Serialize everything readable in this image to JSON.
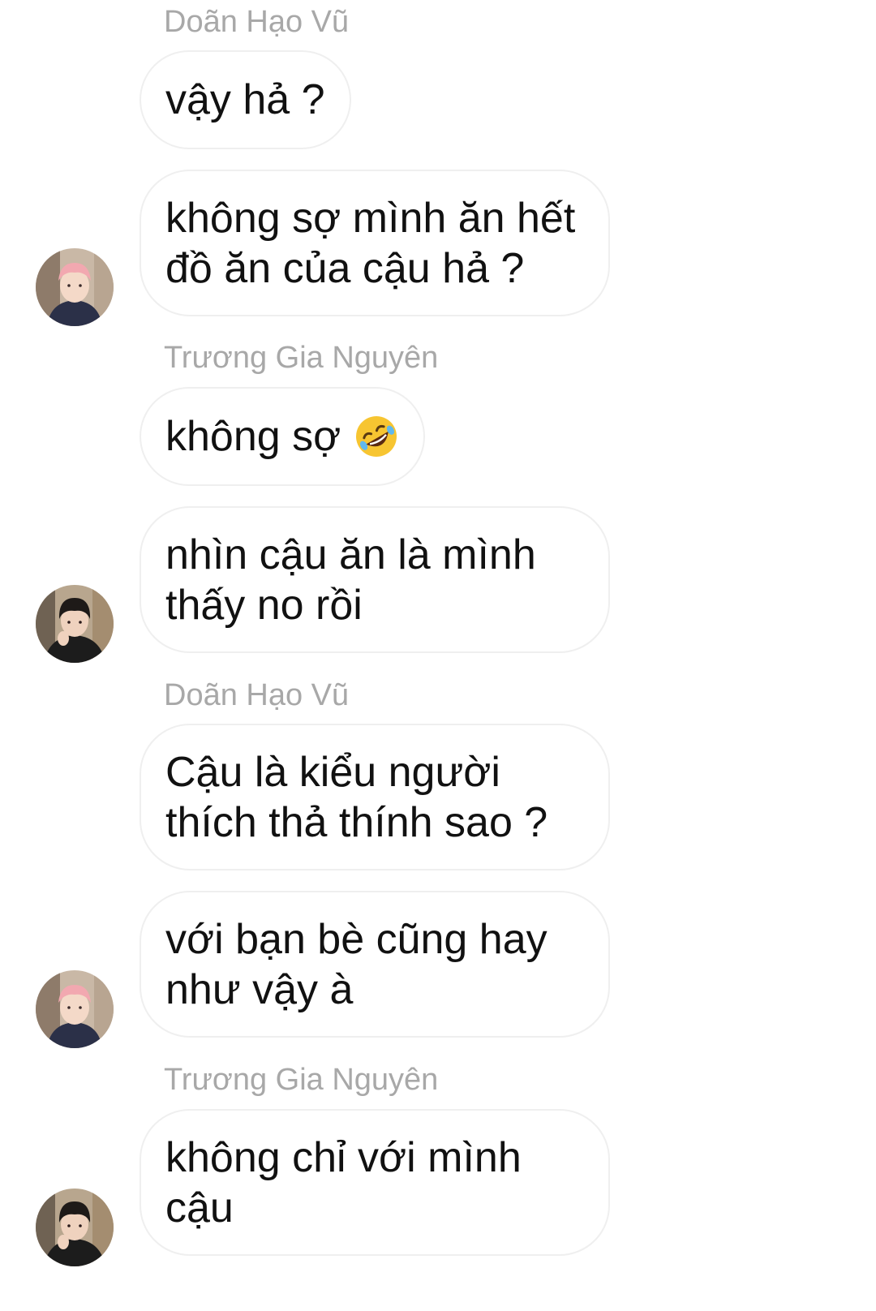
{
  "messages": [
    {
      "sender": "Doãn Hạo Vũ",
      "text": "vậy hả ?"
    },
    {
      "text": "không sợ mình ăn hết\nđồ ăn của cậu hả ?"
    },
    {
      "sender": "Trương Gia Nguyên",
      "text": "không sợ",
      "emoji": "rolling-on-floor-laughing-emoji"
    },
    {
      "text": "nhìn cậu ăn là mình\nthấy no rồi"
    },
    {
      "sender": "Doãn Hạo Vũ",
      "text": "Cậu là kiểu người\nthích thả thính sao ?"
    },
    {
      "text": "với bạn bè cũng hay\nnhư vậy à"
    },
    {
      "sender": "Trương Gia Nguyên",
      "text": "không chỉ với mình\ncậu"
    }
  ],
  "avatars": {
    "doan_hao_vu": {
      "icon": "avatar-pink-hair"
    },
    "truong_gia_nguyen": {
      "icon": "avatar-dark-hair"
    }
  },
  "colors": {
    "bubble_border": "#efefef",
    "sender_name": "#a8a8a8",
    "text": "#111111",
    "background": "#ffffff"
  }
}
